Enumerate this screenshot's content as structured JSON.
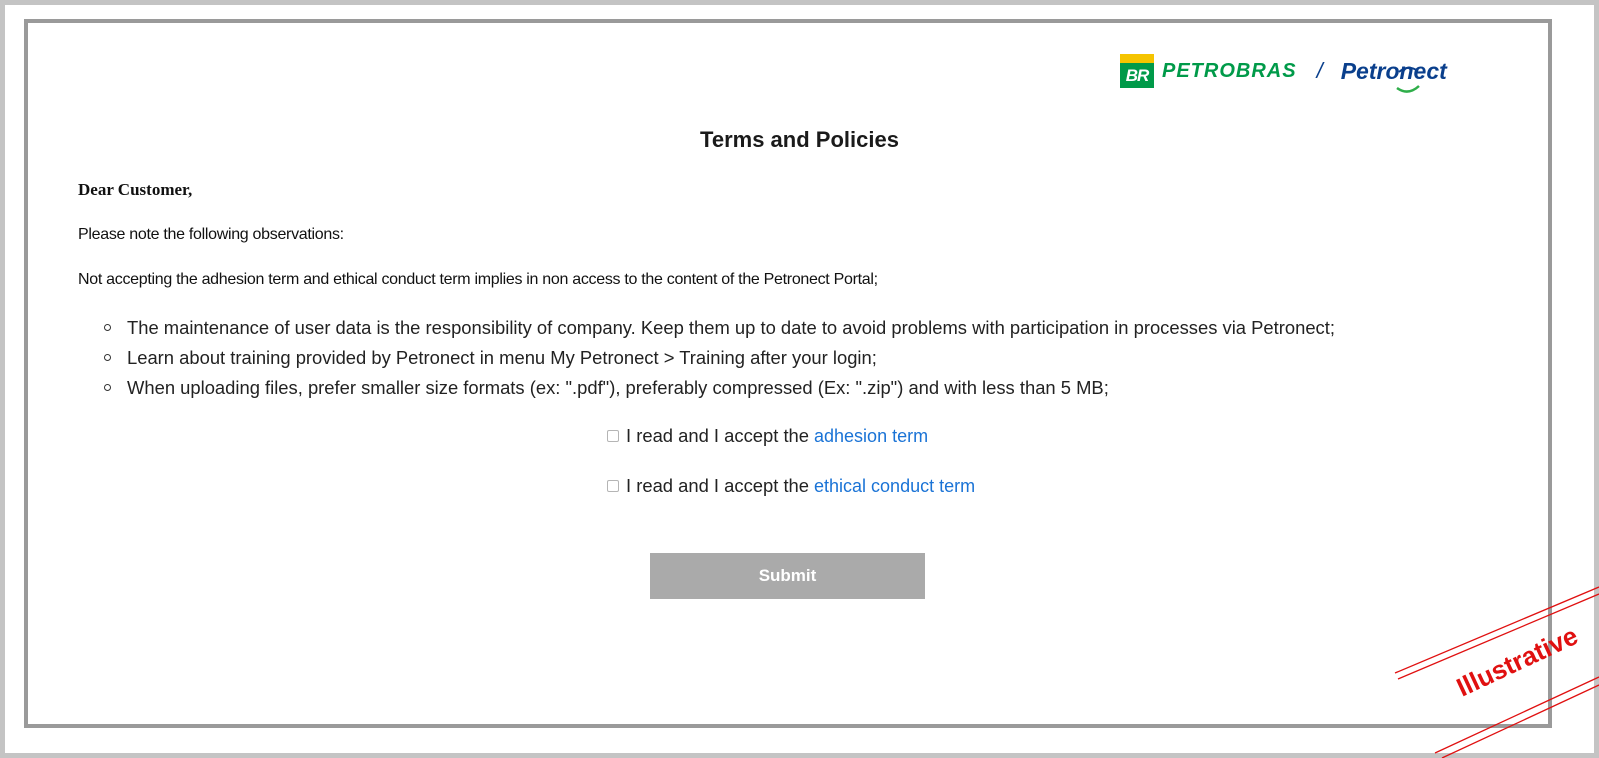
{
  "header": {
    "logo_br_text": "BR",
    "logo_petrobras_text": "PETROBRAS",
    "separator": "/",
    "logo_petronect_text": "Petronect"
  },
  "page": {
    "title": "Terms and Policies",
    "greeting": "Dear Customer,",
    "intro": "Please note the following observations:",
    "notice": "Not accepting the adhesion term and ethical conduct term implies in non access to the content of the Petronect Portal;",
    "observations": [
      "The maintenance of user data is the responsibility of company. Keep them up to date to avoid problems with participation in processes via Petronect;",
      "Learn about training provided by Petronect in menu My Petronect > Training after your login;",
      "When uploading files, prefer smaller size formats (ex: \".pdf\"), preferably compressed (Ex: \".zip\") and with less than 5 MB;"
    ]
  },
  "consents": {
    "adhesion": {
      "label": "I read and I accept the",
      "link_text": "adhesion term",
      "checked": false
    },
    "ethical": {
      "label": "I read and I accept the",
      "link_text": "ethical conduct term",
      "checked": false
    }
  },
  "actions": {
    "submit_label": "Submit",
    "submit_enabled": false
  },
  "watermark": {
    "text": "Illustrative"
  },
  "colors": {
    "petrobras_green": "#009a49",
    "petrobras_yellow": "#f5c400",
    "petronect_blue": "#0a3f8c",
    "link_blue": "#1a73d6",
    "submit_disabled": "#aaaaaa",
    "watermark_red": "#e01010"
  }
}
